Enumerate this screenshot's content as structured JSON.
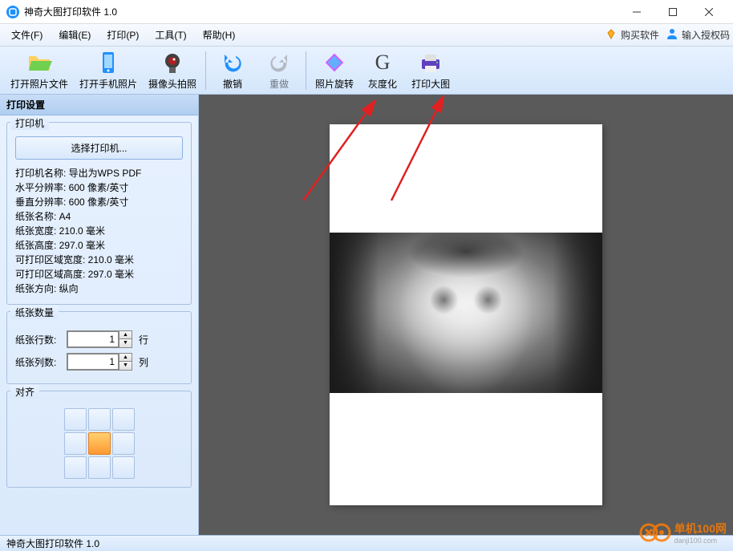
{
  "titlebar": {
    "title": "神奇大图打印软件 1.0"
  },
  "menu": {
    "file": "文件(F)",
    "edit": "编辑(E)",
    "print": "打印(P)",
    "tools": "工具(T)",
    "help": "帮助(H)",
    "buy": "购买软件",
    "auth": "输入授权码"
  },
  "toolbar": {
    "open_file": "打开照片文件",
    "open_phone": "打开手机照片",
    "camera": "摄像头拍照",
    "undo": "撤销",
    "redo": "重做",
    "rotate": "照片旋转",
    "grayscale": "灰度化",
    "print_big": "打印大图"
  },
  "sidebar": {
    "title": "打印设置",
    "printer": {
      "panel_title": "打印机",
      "select_btn": "选择打印机...",
      "info": {
        "name": "打印机名称: 导出为WPS PDF",
        "hres": "水平分辨率: 600 像素/英寸",
        "vres": "垂直分辨率: 600 像素/英寸",
        "paper_name": "纸张名称: A4",
        "paper_w": "纸张宽度: 210.0 毫米",
        "paper_h": "纸张高度: 297.0 毫米",
        "print_w": "可打印区域宽度: 210.0 毫米",
        "print_h": "可打印区域高度: 297.0 毫米",
        "orient": "纸张方向: 纵向"
      }
    },
    "qty": {
      "panel_title": "纸张数量",
      "rows_label": "纸张行数:",
      "rows_value": "1",
      "rows_unit": "行",
      "cols_label": "纸张列数:",
      "cols_value": "1",
      "cols_unit": "列"
    },
    "align": {
      "panel_title": "对齐"
    }
  },
  "statusbar": {
    "text": "神奇大图打印软件 1.0"
  },
  "watermark": {
    "name": "单机100网",
    "url": "danji100.com"
  }
}
